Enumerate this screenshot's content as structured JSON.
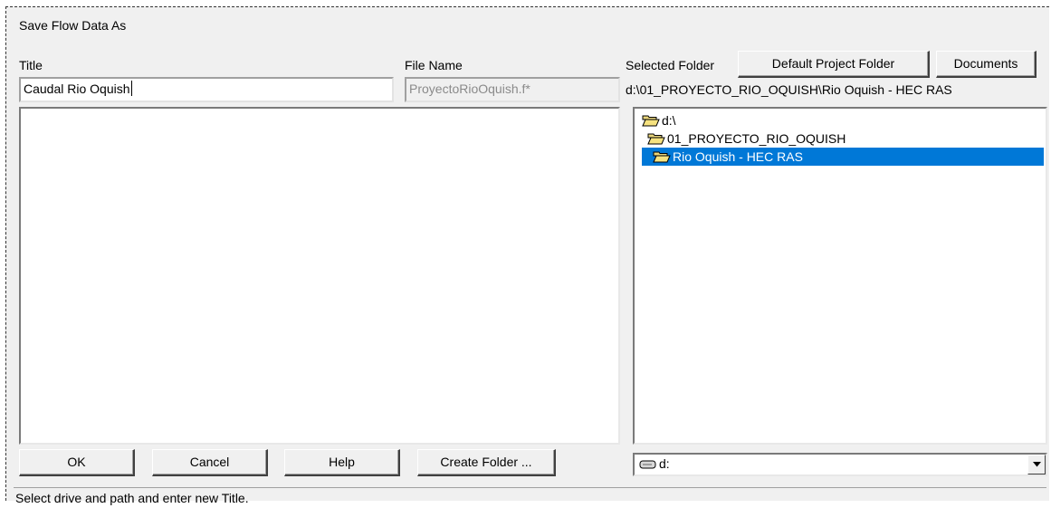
{
  "window": {
    "title": "Save Flow Data As"
  },
  "title_section": {
    "label": "Title",
    "value": "Caudal Rio Oquish"
  },
  "filename_section": {
    "label": "File Name",
    "value": "ProyectoRioOquish.f*"
  },
  "folder_section": {
    "label": "Selected Folder",
    "default_button": "Default Project Folder",
    "documents_button": "Documents",
    "path": "d:\\01_PROYECTO_RIO_OQUISH\\Rio Oquish - HEC RAS"
  },
  "folder_tree": [
    {
      "label": "d:\\",
      "icon": "open-folder-icon",
      "selected": false
    },
    {
      "label": "01_PROYECTO_RIO_OQUISH",
      "icon": "open-folder-icon",
      "selected": false
    },
    {
      "label": "Rio Oquish - HEC RAS",
      "icon": "open-folder-icon",
      "selected": true
    }
  ],
  "buttons": {
    "ok": "OK",
    "cancel": "Cancel",
    "help": "Help",
    "create_folder": "Create Folder ..."
  },
  "drive_select": {
    "value": "d:",
    "icon": "drive-icon"
  },
  "status_bar": {
    "text": "Select drive and path and enter new Title."
  },
  "colors": {
    "selection": "#0078d7",
    "dialog_bg": "#f0f0f0"
  }
}
